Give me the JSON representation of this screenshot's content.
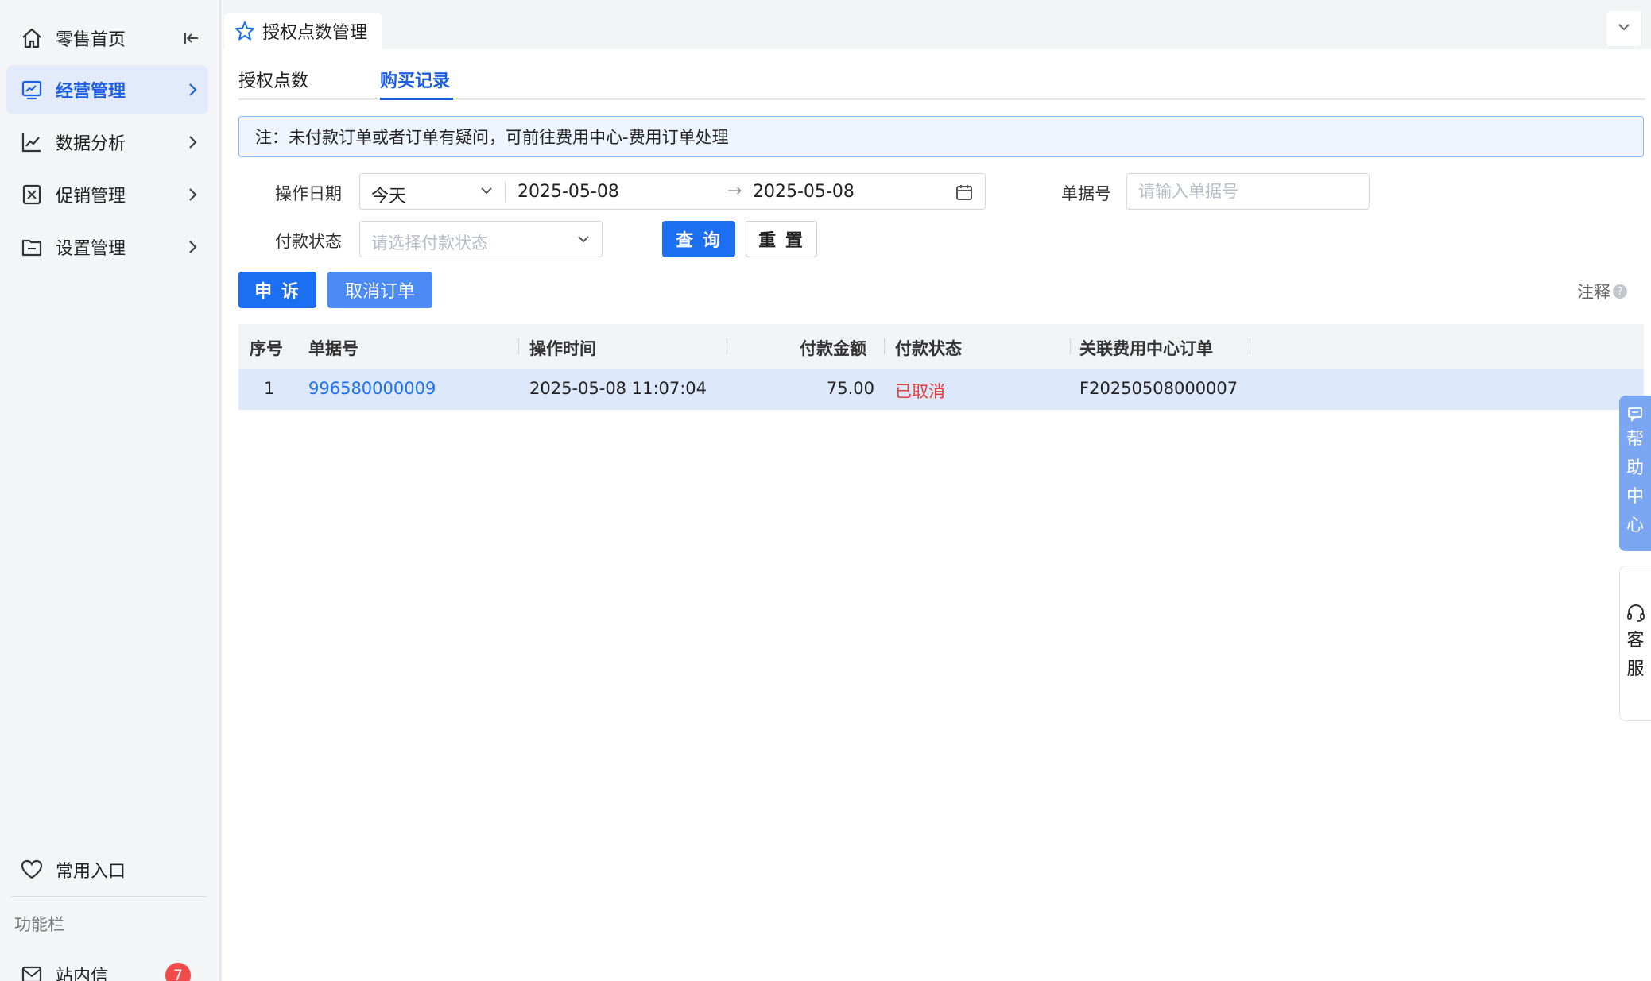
{
  "sidebar": {
    "items": [
      {
        "label": "零售首页",
        "icon": "home-icon"
      },
      {
        "label": "经营管理",
        "icon": "monitor-chart-icon",
        "active": true
      },
      {
        "label": "数据分析",
        "icon": "line-chart-icon"
      },
      {
        "label": "促销管理",
        "icon": "promo-icon"
      },
      {
        "label": "设置管理",
        "icon": "folder-icon"
      }
    ],
    "favorites_label": "常用入口",
    "function_bar_label": "功能栏",
    "messages_label": "站内信",
    "messages_badge": "7"
  },
  "tabbar": {
    "page_tab_label": "授权点数管理"
  },
  "subtabs": {
    "tab1": "授权点数",
    "tab2": "购买记录",
    "active": "购买记录"
  },
  "notice": "注：未付款订单或者订单有疑问，可前往费用中心-费用订单处理",
  "filters": {
    "date_label": "操作日期",
    "date_preset": "今天",
    "date_start": "2025-05-08",
    "date_arrow": "→",
    "date_end": "2025-05-08",
    "doc_no_label": "单据号",
    "doc_no_placeholder": "请输入单据号",
    "pay_status_label": "付款状态",
    "pay_status_placeholder": "请选择付款状态",
    "query_button": "查 询",
    "reset_button": "重 置"
  },
  "actions": {
    "appeal_button": "申 诉",
    "cancel_order_button": "取消订单",
    "annotation_label": "注释",
    "annotation_q": "?"
  },
  "table": {
    "headers": [
      "序号",
      "单据号",
      "操作时间",
      "付款金额",
      "付款状态",
      "关联费用中心订单"
    ],
    "rows": [
      {
        "seq": "1",
        "doc_no": "996580000009",
        "op_time": "2025-05-08 11:07:04",
        "amount": "75.00",
        "status": "已取消",
        "related_order": "F20250508000007"
      }
    ]
  },
  "floats": {
    "help": [
      "帮",
      "助",
      "中",
      "心"
    ],
    "service": [
      "客",
      "服"
    ]
  },
  "colors": {
    "accent": "#1d6ff2",
    "active_nav_bg": "#e3ebfb",
    "danger": "#e53935",
    "row_highlight": "#dde8fb"
  }
}
